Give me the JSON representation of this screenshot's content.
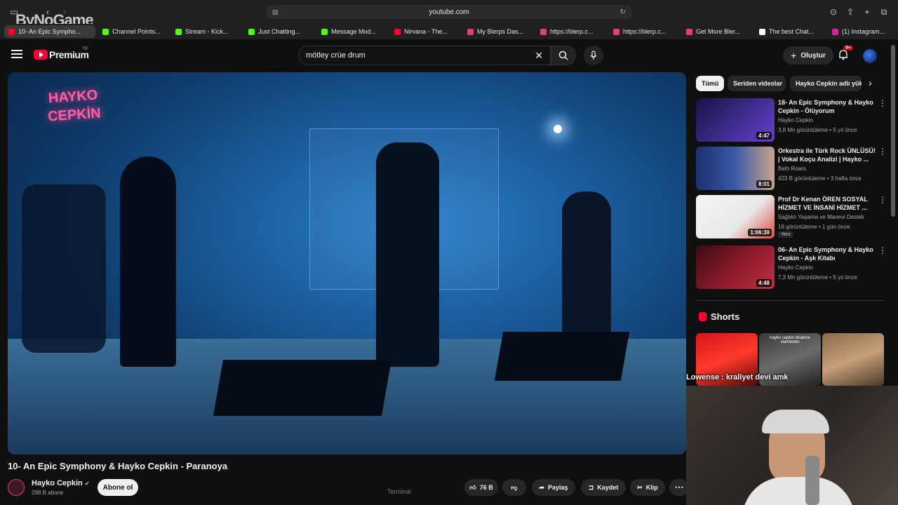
{
  "browser": {
    "url": "youtube.com",
    "tabs": [
      {
        "label": "10- An Epic Sympho...",
        "color": "#ff0033",
        "active": true
      },
      {
        "label": "Channel Points...",
        "color": "#53fc18"
      },
      {
        "label": "Stream - Kick...",
        "color": "#53fc18"
      },
      {
        "label": "Just Chatting...",
        "color": "#53fc18"
      },
      {
        "label": "Message Mod...",
        "color": "#53fc18"
      },
      {
        "label": "Nirvana - The...",
        "color": "#ff0033"
      },
      {
        "label": "My Blerps Das...",
        "color": "#e0407a"
      },
      {
        "label": "https://blerp.c...",
        "color": "#e0407a"
      },
      {
        "label": "https://blerp.c...",
        "color": "#e0407a"
      },
      {
        "label": "Get More Bler...",
        "color": "#e0407a"
      },
      {
        "label": "The best Chat...",
        "color": "#ffffff"
      },
      {
        "label": "(1) Instagram...",
        "color": "#d6249f"
      }
    ],
    "watermark": "ByNoGame"
  },
  "header": {
    "logo_text": "Premium",
    "logo_region": "TR",
    "search_value": "mötley crüe drum",
    "create_label": "Oluştur",
    "notif_count": "9+"
  },
  "video": {
    "title": "10- An Epic Symphony & Hayko Cepkin - Paranoya",
    "overlay_logo_line1": "HAYKO",
    "overlay_logo_line2": "CEPKİN",
    "channel": "Hayko Cepkin",
    "subscribers": "298 B abone",
    "subscribe_label": "Abone ol",
    "likes": "76 B",
    "share_label": "Paylaş",
    "save_label": "Kaydet",
    "clip_label": "Klip",
    "terminal_label": "Terminal"
  },
  "sidebar": {
    "chips": [
      "Tümü",
      "Seriden videolar",
      "Hayko Cepkin adlı yük"
    ],
    "recommendations": [
      {
        "title": "18- An Epic Symphony & Hayko Cepkin - Ölüyorum",
        "channel": "Hayko Cepkin",
        "meta": "3,8 Mn görüntüleme • 5 yıl önce",
        "duration": "4:47",
        "thumb": "linear-gradient(135deg,#1a1244,#3b2b8a 50%,#6b3fcf)"
      },
      {
        "title": "Orkestra ile Türk Rock ÜNLÜSÜ! | Vokal Koçu Analizi | Hayko ...",
        "channel": "Beth Roars",
        "meta": "423 B görüntüleme • 3 hafta önce",
        "duration": "8:01",
        "thumb": "linear-gradient(90deg,#1b2f6b,#3a5aa8 50%,#c9a48a)"
      },
      {
        "title": "Prof  Dr Kenan ÖREN  SOSYAL HİZMET VE İNSANİ HİZMET ...",
        "channel": "Sağlıklı Yaşama ve Manevi Destek",
        "meta": "16 görüntüleme • 1 gün önce",
        "duration": "1:06:39",
        "thumb": "linear-gradient(135deg,#f4f4f4,#e8e8e8 60%,#e04a3a)",
        "badge": "Yeni"
      },
      {
        "title": "06- An Epic Symphony & Hayko Cepkin - Aşk Kitabı",
        "channel": "Hayko Cepkin",
        "meta": "7,3 Mn görüntüleme • 5 yıl önce",
        "duration": "4:48",
        "thumb": "linear-gradient(135deg,#3a0b14,#8a1a2a 50%,#c23040)"
      }
    ],
    "shorts_label": "Shorts",
    "short_overlay_2": "hayko cepkin binance slamdown"
  },
  "overlay": {
    "stream_text": "Lowense : kraliyet devi amk"
  }
}
